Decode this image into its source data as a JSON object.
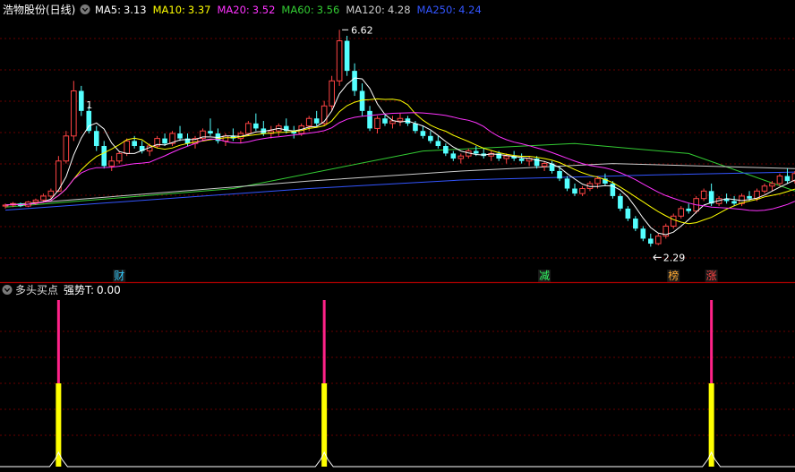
{
  "main": {
    "title": "浩物股份(日线)",
    "ma_legend": [
      {
        "label": "MA5:",
        "value": "3.13",
        "color": "#ffffff"
      },
      {
        "label": "MA10:",
        "value": "3.37",
        "color": "#ffff00"
      },
      {
        "label": "MA20:",
        "value": "3.52",
        "color": "#ff33ff"
      },
      {
        "label": "MA60:",
        "value": "3.56",
        "color": "#33cc33"
      },
      {
        "label": "MA120:",
        "value": "4.28",
        "color": "#cccccc"
      },
      {
        "label": "MA250:",
        "value": "4.24",
        "color": "#3355ff"
      }
    ],
    "high_label": "6.62",
    "low_label": "2.29",
    "marker_1": "1",
    "events": [
      {
        "label": "财",
        "color": "#33ccff"
      },
      {
        "label": "减",
        "color": "#33ff66"
      },
      {
        "label": "榜",
        "color": "#ffaa33"
      },
      {
        "label": "涨",
        "color": "#ff4444"
      }
    ]
  },
  "sub": {
    "title": "多头买点",
    "indicator_label": "强势T:",
    "indicator_value": "0.00"
  },
  "colors": {
    "up": "#ff4444",
    "down": "#54ffff",
    "grid": "#8b0000",
    "divider": "#b00000",
    "signal_top": "#ff2288",
    "signal_bottom": "#ffff00"
  },
  "chart_data": [
    {
      "type": "candlestick",
      "title": "浩物股份(日线)",
      "y_range": [
        1.85,
        6.75
      ],
      "ohlc": [
        [
          3.1,
          3.15,
          3.05,
          3.12
        ],
        [
          3.12,
          3.18,
          3.08,
          3.15
        ],
        [
          3.15,
          3.17,
          3.08,
          3.1
        ],
        [
          3.1,
          3.2,
          3.08,
          3.18
        ],
        [
          3.18,
          3.25,
          3.12,
          3.22
        ],
        [
          3.22,
          3.35,
          3.18,
          3.3
        ],
        [
          3.3,
          3.45,
          3.25,
          3.4
        ],
        [
          3.4,
          4.1,
          3.38,
          4.0
        ],
        [
          4.0,
          4.6,
          3.95,
          4.5
        ],
        [
          4.5,
          5.6,
          4.4,
          5.4
        ],
        [
          5.4,
          5.5,
          4.9,
          5.0
        ],
        [
          5.0,
          5.1,
          4.55,
          4.6
        ],
        [
          4.6,
          4.7,
          4.2,
          4.3
        ],
        [
          4.3,
          4.4,
          3.85,
          3.9
        ],
        [
          3.9,
          4.1,
          3.8,
          4.0
        ],
        [
          4.0,
          4.2,
          3.95,
          4.15
        ],
        [
          4.15,
          4.45,
          4.1,
          4.4
        ],
        [
          4.4,
          4.5,
          4.25,
          4.3
        ],
        [
          4.3,
          4.4,
          4.15,
          4.2
        ],
        [
          4.2,
          4.35,
          4.1,
          4.3
        ],
        [
          4.3,
          4.5,
          4.25,
          4.45
        ],
        [
          4.45,
          4.55,
          4.3,
          4.35
        ],
        [
          4.35,
          4.6,
          4.3,
          4.55
        ],
        [
          4.55,
          4.7,
          4.4,
          4.45
        ],
        [
          4.45,
          4.55,
          4.3,
          4.35
        ],
        [
          4.35,
          4.5,
          4.25,
          4.45
        ],
        [
          4.45,
          4.65,
          4.4,
          4.6
        ],
        [
          4.6,
          4.85,
          4.5,
          4.55
        ],
        [
          4.55,
          4.65,
          4.35,
          4.4
        ],
        [
          4.4,
          4.55,
          4.3,
          4.5
        ],
        [
          4.5,
          4.65,
          4.4,
          4.45
        ],
        [
          4.45,
          4.6,
          4.35,
          4.55
        ],
        [
          4.55,
          4.8,
          4.5,
          4.75
        ],
        [
          4.75,
          4.95,
          4.6,
          4.65
        ],
        [
          4.65,
          4.8,
          4.5,
          4.55
        ],
        [
          4.55,
          4.7,
          4.45,
          4.6
        ],
        [
          4.6,
          4.75,
          4.5,
          4.7
        ],
        [
          4.7,
          4.85,
          4.55,
          4.6
        ],
        [
          4.6,
          4.7,
          4.45,
          4.55
        ],
        [
          4.55,
          4.75,
          4.5,
          4.7
        ],
        [
          4.7,
          4.9,
          4.6,
          4.85
        ],
        [
          4.85,
          5.0,
          4.7,
          4.75
        ],
        [
          4.75,
          5.2,
          4.7,
          5.1
        ],
        [
          5.1,
          5.7,
          5.0,
          5.6
        ],
        [
          5.6,
          6.62,
          5.5,
          6.4
        ],
        [
          6.4,
          6.5,
          5.7,
          5.8
        ],
        [
          5.8,
          5.95,
          5.3,
          5.4
        ],
        [
          5.4,
          5.55,
          4.9,
          5.0
        ],
        [
          5.0,
          5.1,
          4.6,
          4.65
        ],
        [
          4.65,
          4.9,
          4.55,
          4.85
        ],
        [
          4.85,
          4.95,
          4.7,
          4.75
        ],
        [
          4.75,
          4.9,
          4.65,
          4.8
        ],
        [
          4.8,
          4.95,
          4.7,
          4.85
        ],
        [
          4.85,
          4.9,
          4.7,
          4.75
        ],
        [
          4.75,
          4.8,
          4.55,
          4.6
        ],
        [
          4.6,
          4.7,
          4.45,
          4.5
        ],
        [
          4.5,
          4.6,
          4.35,
          4.4
        ],
        [
          4.4,
          4.5,
          4.25,
          4.3
        ],
        [
          4.3,
          4.35,
          4.1,
          4.15
        ],
        [
          4.15,
          4.2,
          4.0,
          4.05
        ],
        [
          4.05,
          4.15,
          3.95,
          4.1
        ],
        [
          4.1,
          4.25,
          4.05,
          4.2
        ],
        [
          4.2,
          4.3,
          4.1,
          4.15
        ],
        [
          4.15,
          4.25,
          4.05,
          4.1
        ],
        [
          4.1,
          4.2,
          4.0,
          4.15
        ],
        [
          4.15,
          4.2,
          4.0,
          4.05
        ],
        [
          4.05,
          4.15,
          3.95,
          4.1
        ],
        [
          4.1,
          4.2,
          4.0,
          4.05
        ],
        [
          4.05,
          4.15,
          3.95,
          4.0
        ],
        [
          4.0,
          4.1,
          3.9,
          4.05
        ],
        [
          4.05,
          4.1,
          3.85,
          3.9
        ],
        [
          3.9,
          4.0,
          3.8,
          3.95
        ],
        [
          3.95,
          4.0,
          3.75,
          3.8
        ],
        [
          3.8,
          3.9,
          3.6,
          3.65
        ],
        [
          3.65,
          3.7,
          3.4,
          3.45
        ],
        [
          3.45,
          3.55,
          3.3,
          3.35
        ],
        [
          3.35,
          3.5,
          3.3,
          3.45
        ],
        [
          3.45,
          3.6,
          3.4,
          3.55
        ],
        [
          3.55,
          3.7,
          3.45,
          3.65
        ],
        [
          3.65,
          3.75,
          3.5,
          3.55
        ],
        [
          3.55,
          3.6,
          3.25,
          3.3
        ],
        [
          3.3,
          3.35,
          3.0,
          3.05
        ],
        [
          3.05,
          3.1,
          2.8,
          2.85
        ],
        [
          2.85,
          2.9,
          2.6,
          2.65
        ],
        [
          2.65,
          2.7,
          2.4,
          2.45
        ],
        [
          2.45,
          2.55,
          2.29,
          2.35
        ],
        [
          2.35,
          2.55,
          2.32,
          2.5
        ],
        [
          2.5,
          2.75,
          2.45,
          2.7
        ],
        [
          2.7,
          2.95,
          2.65,
          2.9
        ],
        [
          2.9,
          3.1,
          2.85,
          3.05
        ],
        [
          3.05,
          3.15,
          2.95,
          3.0
        ],
        [
          3.0,
          3.3,
          2.95,
          3.25
        ],
        [
          3.25,
          3.45,
          3.2,
          3.4
        ],
        [
          3.4,
          3.55,
          3.1,
          3.15
        ],
        [
          3.15,
          3.3,
          3.1,
          3.25
        ],
        [
          3.25,
          3.35,
          3.15,
          3.2
        ],
        [
          3.2,
          3.3,
          3.1,
          3.15
        ],
        [
          3.15,
          3.35,
          3.1,
          3.3
        ],
        [
          3.3,
          3.4,
          3.2,
          3.25
        ],
        [
          3.25,
          3.45,
          3.2,
          3.4
        ],
        [
          3.4,
          3.55,
          3.35,
          3.5
        ],
        [
          3.5,
          3.6,
          3.4,
          3.55
        ],
        [
          3.55,
          3.75,
          3.5,
          3.7
        ],
        [
          3.7,
          3.85,
          3.55,
          3.6
        ],
        [
          3.6,
          3.8,
          3.55,
          3.75
        ]
      ],
      "moving_averages": [
        {
          "name": "MA5",
          "period": 5,
          "color": "#ffffff"
        },
        {
          "name": "MA10",
          "period": 10,
          "color": "#ffff00"
        },
        {
          "name": "MA20",
          "period": 20,
          "color": "#ff33ff"
        }
      ],
      "reference_lines": [
        {
          "name": "MA60",
          "color": "#33cc33",
          "points": [
            [
              0,
              3.08
            ],
            [
              30,
              3.45
            ],
            [
              55,
              4.2
            ],
            [
              75,
              4.35
            ],
            [
              90,
              4.15
            ],
            [
              104,
              3.4
            ]
          ]
        },
        {
          "name": "MA120",
          "color": "#cccccc",
          "points": [
            [
              0,
              3.12
            ],
            [
              40,
              3.6
            ],
            [
              60,
              3.8
            ],
            [
              80,
              3.95
            ],
            [
              104,
              3.85
            ]
          ]
        },
        {
          "name": "MA250",
          "color": "#3355ff",
          "points": [
            [
              0,
              3.02
            ],
            [
              40,
              3.45
            ],
            [
              60,
              3.62
            ],
            [
              85,
              3.72
            ],
            [
              104,
              3.78
            ]
          ]
        }
      ],
      "event_markers": [
        {
          "label": "财",
          "index": 15
        },
        {
          "label": "减",
          "index": 71
        },
        {
          "label": "榜",
          "index": 88
        },
        {
          "label": "涨",
          "index": 93
        }
      ],
      "high_point": {
        "index": 44,
        "value": 6.62
      },
      "low_point": {
        "index": 85,
        "value": 2.29
      },
      "annotation": {
        "label": "1",
        "index": 11,
        "value": 5.05
      }
    },
    {
      "type": "bar",
      "title": "多头买点",
      "y_range": [
        0,
        1
      ],
      "signals": [
        {
          "index": 7,
          "value": 1.0
        },
        {
          "index": 42,
          "value": 1.0
        },
        {
          "index": 93,
          "value": 1.0
        }
      ],
      "indicator": {
        "name": "强势T",
        "value": 0.0
      }
    }
  ]
}
